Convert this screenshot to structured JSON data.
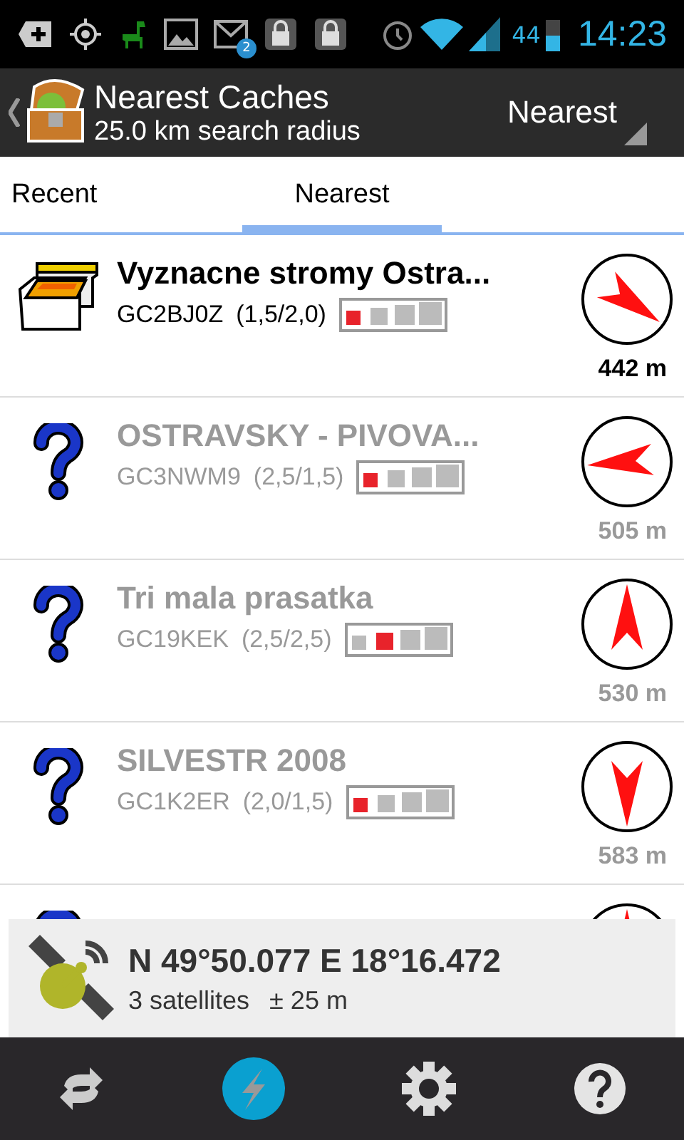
{
  "status_bar": {
    "notification_badge": "2",
    "battery": "44",
    "time": "14:23"
  },
  "action_bar": {
    "title": "Nearest Caches",
    "subtitle": "25.0 km search radius",
    "sort": "Nearest"
  },
  "tabs": [
    {
      "label": "Recent",
      "selected": false
    },
    {
      "label": "Nearest",
      "selected": true
    }
  ],
  "caches": [
    {
      "kind": "traditional",
      "name": "Vyznacne stromy Ostra...",
      "code": "GC2BJ0Z",
      "rating": "(1,5/2,0)",
      "size_marks": [
        {
          "selected": true
        },
        {
          "selected": false
        },
        {
          "selected": false
        },
        {
          "selected": false
        }
      ],
      "bearing": {
        "kind": "southeast"
      },
      "distance": "442 m",
      "dimmed": false
    },
    {
      "kind": "unknown",
      "name": "OSTRAVSKY - PIVOVA...",
      "code": "GC3NWM9",
      "rating": "(2,5/1,5)",
      "size_marks": [
        {
          "selected": true
        },
        {
          "selected": false
        },
        {
          "selected": false
        },
        {
          "selected": false
        }
      ],
      "bearing": {
        "kind": "west"
      },
      "distance": "505 m",
      "dimmed": true
    },
    {
      "kind": "unknown",
      "name": "Tri mala prasatka",
      "code": "GC19KEK",
      "rating": "(2,5/2,5)",
      "size_marks": [
        {
          "selected": false
        },
        {
          "selected": true
        },
        {
          "selected": false
        },
        {
          "selected": false
        }
      ],
      "bearing": {
        "kind": "north"
      },
      "distance": "530 m",
      "dimmed": true
    },
    {
      "kind": "unknown",
      "name": "SILVESTR 2008",
      "code": "GC1K2ER",
      "rating": "(2,0/1,5)",
      "size_marks": [
        {
          "selected": true
        },
        {
          "selected": false
        },
        {
          "selected": false
        },
        {
          "selected": false
        }
      ],
      "bearing": {
        "kind": "south"
      },
      "distance": "583 m",
      "dimmed": true
    },
    {
      "kind": "unknown",
      "bearing": {
        "kind": "north"
      }
    }
  ],
  "location": {
    "coordinates": "N 49°50.077 E 18°16.472",
    "satellites": "3 satellites",
    "accuracy": "± 25 m"
  }
}
